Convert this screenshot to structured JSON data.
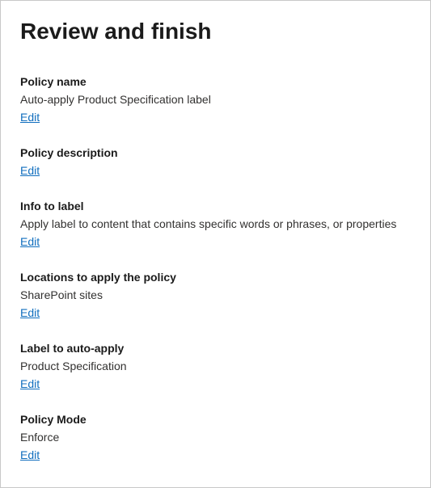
{
  "page_title": "Review and finish",
  "sections": {
    "policy_name": {
      "heading": "Policy name",
      "value": "Auto-apply Product Specification label",
      "edit": "Edit"
    },
    "policy_description": {
      "heading": "Policy description",
      "edit": "Edit"
    },
    "info_to_label": {
      "heading": "Info to label",
      "value": "Apply label to content that contains specific words or phrases, or properties",
      "edit": "Edit"
    },
    "locations": {
      "heading": "Locations to apply the policy",
      "value": "SharePoint sites",
      "edit": "Edit"
    },
    "label_to_auto_apply": {
      "heading": "Label to auto-apply",
      "value": "Product Specification",
      "edit": "Edit"
    },
    "policy_mode": {
      "heading": "Policy Mode",
      "value": "Enforce",
      "edit": "Edit"
    }
  }
}
